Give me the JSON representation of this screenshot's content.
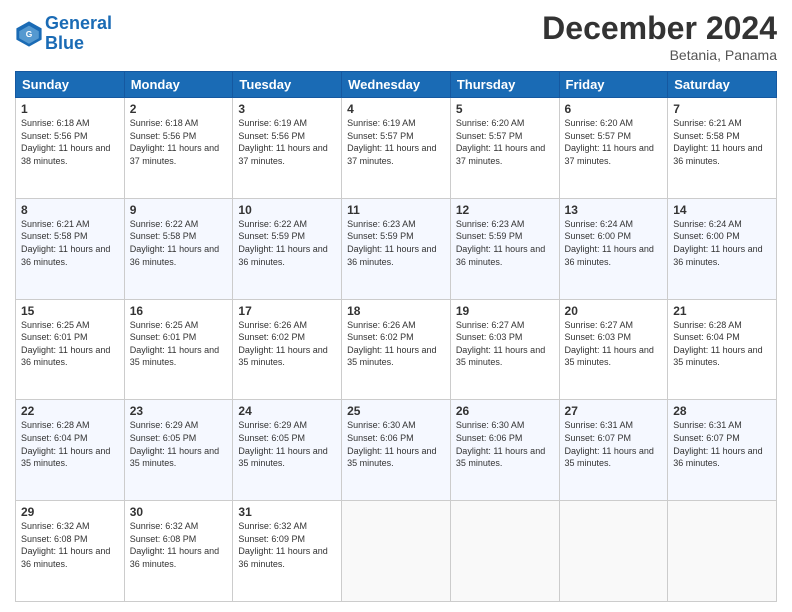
{
  "logo": {
    "line1": "General",
    "line2": "Blue"
  },
  "title": "December 2024",
  "location": "Betania, Panama",
  "days_of_week": [
    "Sunday",
    "Monday",
    "Tuesday",
    "Wednesday",
    "Thursday",
    "Friday",
    "Saturday"
  ],
  "weeks": [
    [
      {
        "day": "1",
        "sunrise": "6:18 AM",
        "sunset": "5:56 PM",
        "daylight": "11 hours and 38 minutes."
      },
      {
        "day": "2",
        "sunrise": "6:18 AM",
        "sunset": "5:56 PM",
        "daylight": "11 hours and 37 minutes."
      },
      {
        "day": "3",
        "sunrise": "6:19 AM",
        "sunset": "5:56 PM",
        "daylight": "11 hours and 37 minutes."
      },
      {
        "day": "4",
        "sunrise": "6:19 AM",
        "sunset": "5:57 PM",
        "daylight": "11 hours and 37 minutes."
      },
      {
        "day": "5",
        "sunrise": "6:20 AM",
        "sunset": "5:57 PM",
        "daylight": "11 hours and 37 minutes."
      },
      {
        "day": "6",
        "sunrise": "6:20 AM",
        "sunset": "5:57 PM",
        "daylight": "11 hours and 37 minutes."
      },
      {
        "day": "7",
        "sunrise": "6:21 AM",
        "sunset": "5:58 PM",
        "daylight": "11 hours and 36 minutes."
      }
    ],
    [
      {
        "day": "8",
        "sunrise": "6:21 AM",
        "sunset": "5:58 PM",
        "daylight": "11 hours and 36 minutes."
      },
      {
        "day": "9",
        "sunrise": "6:22 AM",
        "sunset": "5:58 PM",
        "daylight": "11 hours and 36 minutes."
      },
      {
        "day": "10",
        "sunrise": "6:22 AM",
        "sunset": "5:59 PM",
        "daylight": "11 hours and 36 minutes."
      },
      {
        "day": "11",
        "sunrise": "6:23 AM",
        "sunset": "5:59 PM",
        "daylight": "11 hours and 36 minutes."
      },
      {
        "day": "12",
        "sunrise": "6:23 AM",
        "sunset": "5:59 PM",
        "daylight": "11 hours and 36 minutes."
      },
      {
        "day": "13",
        "sunrise": "6:24 AM",
        "sunset": "6:00 PM",
        "daylight": "11 hours and 36 minutes."
      },
      {
        "day": "14",
        "sunrise": "6:24 AM",
        "sunset": "6:00 PM",
        "daylight": "11 hours and 36 minutes."
      }
    ],
    [
      {
        "day": "15",
        "sunrise": "6:25 AM",
        "sunset": "6:01 PM",
        "daylight": "11 hours and 36 minutes."
      },
      {
        "day": "16",
        "sunrise": "6:25 AM",
        "sunset": "6:01 PM",
        "daylight": "11 hours and 35 minutes."
      },
      {
        "day": "17",
        "sunrise": "6:26 AM",
        "sunset": "6:02 PM",
        "daylight": "11 hours and 35 minutes."
      },
      {
        "day": "18",
        "sunrise": "6:26 AM",
        "sunset": "6:02 PM",
        "daylight": "11 hours and 35 minutes."
      },
      {
        "day": "19",
        "sunrise": "6:27 AM",
        "sunset": "6:03 PM",
        "daylight": "11 hours and 35 minutes."
      },
      {
        "day": "20",
        "sunrise": "6:27 AM",
        "sunset": "6:03 PM",
        "daylight": "11 hours and 35 minutes."
      },
      {
        "day": "21",
        "sunrise": "6:28 AM",
        "sunset": "6:04 PM",
        "daylight": "11 hours and 35 minutes."
      }
    ],
    [
      {
        "day": "22",
        "sunrise": "6:28 AM",
        "sunset": "6:04 PM",
        "daylight": "11 hours and 35 minutes."
      },
      {
        "day": "23",
        "sunrise": "6:29 AM",
        "sunset": "6:05 PM",
        "daylight": "11 hours and 35 minutes."
      },
      {
        "day": "24",
        "sunrise": "6:29 AM",
        "sunset": "6:05 PM",
        "daylight": "11 hours and 35 minutes."
      },
      {
        "day": "25",
        "sunrise": "6:30 AM",
        "sunset": "6:06 PM",
        "daylight": "11 hours and 35 minutes."
      },
      {
        "day": "26",
        "sunrise": "6:30 AM",
        "sunset": "6:06 PM",
        "daylight": "11 hours and 35 minutes."
      },
      {
        "day": "27",
        "sunrise": "6:31 AM",
        "sunset": "6:07 PM",
        "daylight": "11 hours and 35 minutes."
      },
      {
        "day": "28",
        "sunrise": "6:31 AM",
        "sunset": "6:07 PM",
        "daylight": "11 hours and 36 minutes."
      }
    ],
    [
      {
        "day": "29",
        "sunrise": "6:32 AM",
        "sunset": "6:08 PM",
        "daylight": "11 hours and 36 minutes."
      },
      {
        "day": "30",
        "sunrise": "6:32 AM",
        "sunset": "6:08 PM",
        "daylight": "11 hours and 36 minutes."
      },
      {
        "day": "31",
        "sunrise": "6:32 AM",
        "sunset": "6:09 PM",
        "daylight": "11 hours and 36 minutes."
      },
      null,
      null,
      null,
      null
    ]
  ]
}
